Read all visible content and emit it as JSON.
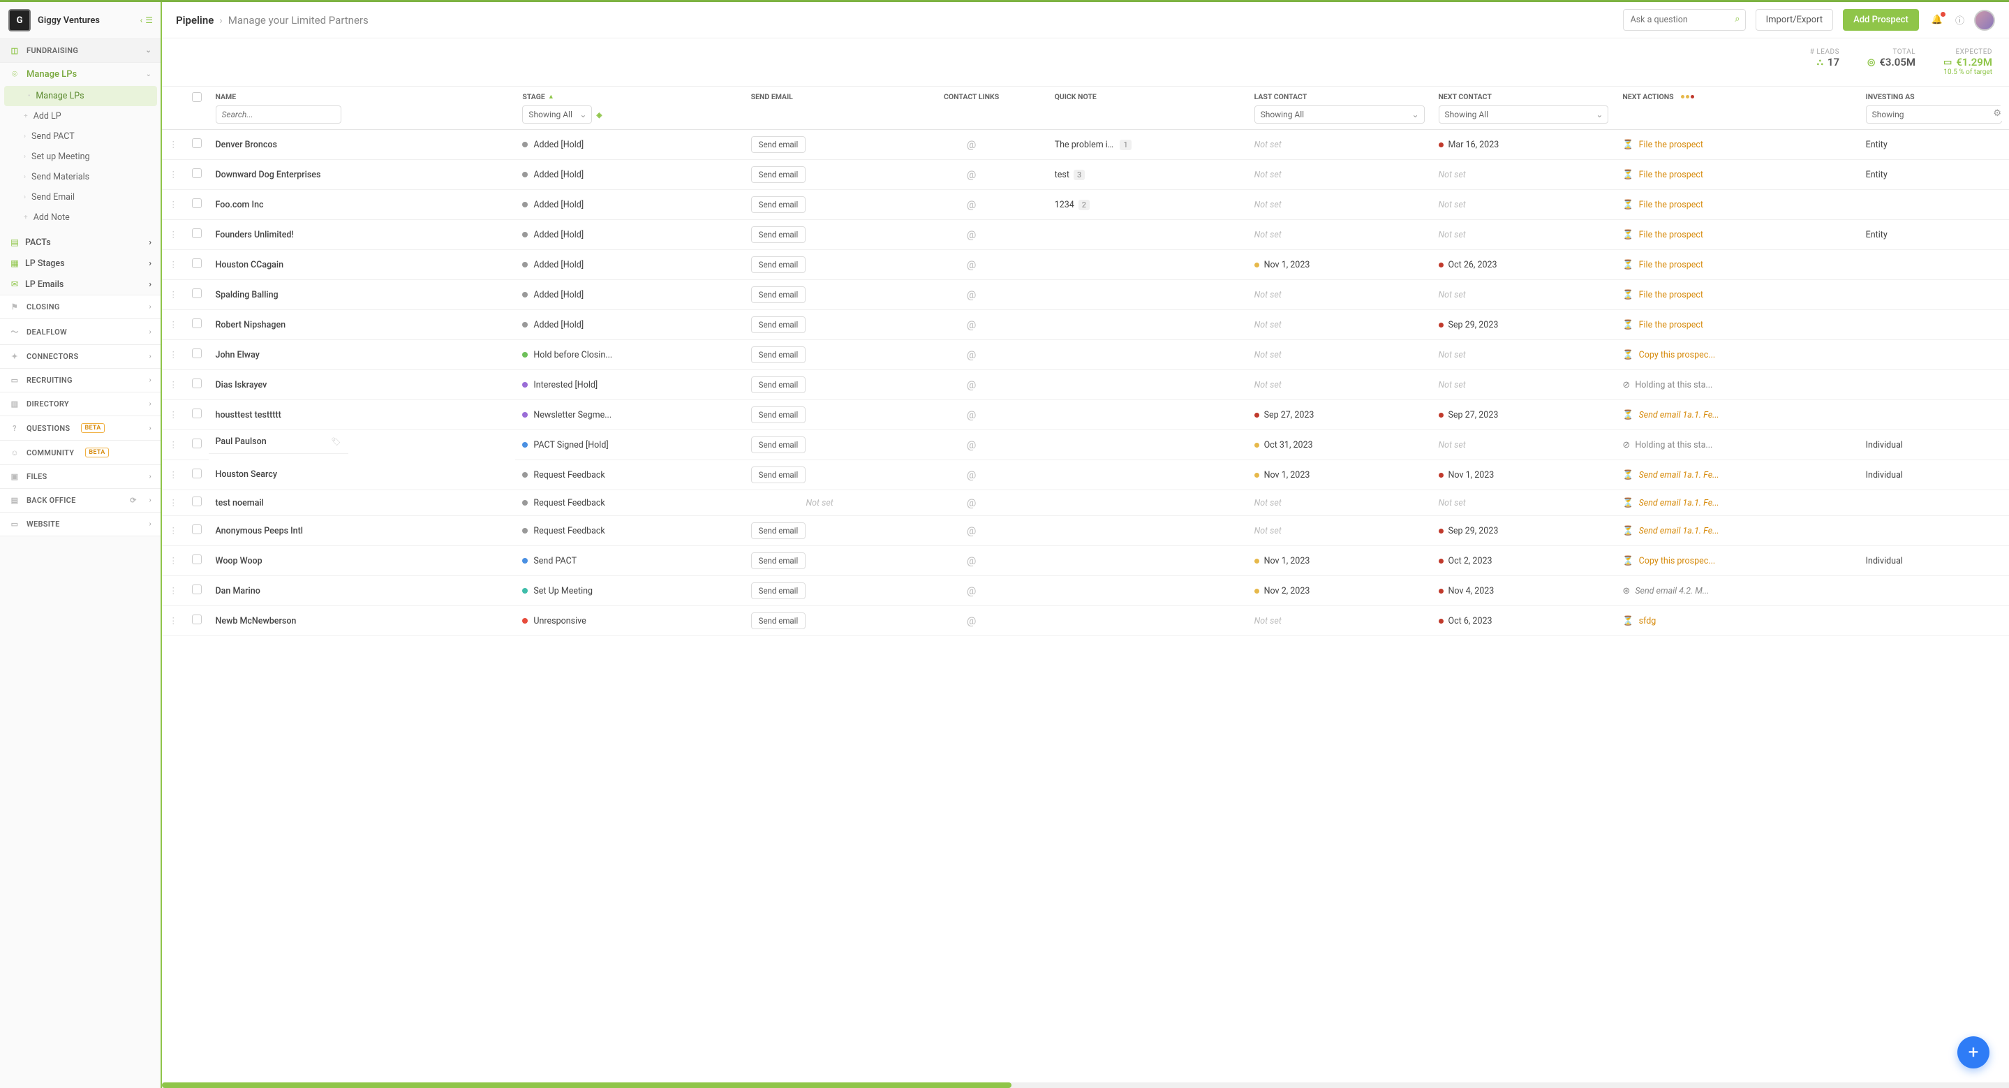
{
  "brand": {
    "logo": "G",
    "name": "Giggy Ventures"
  },
  "header": {
    "crumb1": "Pipeline",
    "crumb2": "Manage your Limited Partners",
    "search_ph": "Ask a question",
    "import": "Import/Export",
    "add": "Add Prospect"
  },
  "sidebar": {
    "fundraising": "FUNDRAISING",
    "manage_lps": "Manage LPs",
    "sub": {
      "manage": "Manage LPs",
      "add_lp": "Add LP",
      "send_pact": "Send PACT",
      "setup": "Set up Meeting",
      "materials": "Send Materials",
      "send_email": "Send Email",
      "add_note": "Add Note"
    },
    "pacts": "PACTs",
    "stages": "LP Stages",
    "emails": "LP Emails",
    "closing": "CLOSING",
    "dealflow": "DEALFLOW",
    "connectors": "CONNECTORS",
    "recruiting": "RECRUITING",
    "directory": "DIRECTORY",
    "questions": "QUESTIONS",
    "community": "COMMUNITY",
    "files": "FILES",
    "backoffice": "BACK OFFICE",
    "website": "WEBSITE",
    "beta": "BETA"
  },
  "metrics": {
    "leads_lbl": "# LEADS",
    "leads_val": "17",
    "total_lbl": "TOTAL",
    "total_val": "€3.05M",
    "exp_lbl": "EXPECTED",
    "exp_val": "€1.29M",
    "exp_sub": "10.5 % of target"
  },
  "cols": {
    "name": "NAME",
    "stage": "STAGE",
    "send": "SEND EMAIL",
    "links": "CONTACT LINKS",
    "note": "QUICK NOTE",
    "last": "LAST CONTACT",
    "next": "NEXT CONTACT",
    "actions": "NEXT ACTIONS",
    "invest": "INVESTING AS",
    "search_ph": "Search...",
    "showing": "Showing All",
    "showing2": "Showing"
  },
  "common": {
    "send_btn": "Send email",
    "notset": "Not set"
  },
  "rows": [
    {
      "name": "Denver Broncos",
      "stage": "Added [Hold]",
      "sc": "#999",
      "email": true,
      "note": "The problem is not...",
      "nc": "1",
      "last": "",
      "next": "Mar 16, 2023",
      "nd": "#c0392b",
      "action": "File the prospect",
      "ai": "⏳",
      "ac": "orange",
      "invest": "Entity"
    },
    {
      "name": "Downward Dog Enterprises",
      "stage": "Added [Hold]",
      "sc": "#999",
      "email": true,
      "note": "test",
      "nc": "3",
      "last": "",
      "next": "",
      "action": "File the prospect",
      "ai": "⏳",
      "ac": "orange",
      "invest": "Entity"
    },
    {
      "name": "Foo.com Inc",
      "stage": "Added [Hold]",
      "sc": "#999",
      "email": true,
      "note": "1234",
      "nc": "2",
      "last": "",
      "next": "",
      "action": "File the prospect",
      "ai": "⏳",
      "ac": "orange",
      "invest": ""
    },
    {
      "name": "Founders Unlimited!",
      "stage": "Added [Hold]",
      "sc": "#999",
      "email": true,
      "last": "",
      "next": "",
      "action": "File the prospect",
      "ai": "⏳",
      "ac": "orange",
      "invest": "Entity"
    },
    {
      "name": "Houston CCagain",
      "stage": "Added [Hold]",
      "sc": "#999",
      "email": true,
      "last": "Nov 1, 2023",
      "ld": "#e6b84a",
      "next": "Oct 26, 2023",
      "nd": "#c0392b",
      "action": "File the prospect",
      "ai": "⏳",
      "ac": "orange",
      "invest": ""
    },
    {
      "name": "Spalding Balling",
      "stage": "Added [Hold]",
      "sc": "#999",
      "email": true,
      "last": "",
      "next": "",
      "action": "File the prospect",
      "ai": "⏳",
      "ac": "orange",
      "invest": ""
    },
    {
      "name": "Robert Nipshagen",
      "stage": "Added [Hold]",
      "sc": "#999",
      "email": true,
      "last": "",
      "next": "Sep 29, 2023",
      "nd": "#c0392b",
      "action": "File the prospect",
      "ai": "⏳",
      "ac": "orange",
      "invest": ""
    },
    {
      "name": "John Elway",
      "stage": "Hold before Closin...",
      "sc": "#6ec05a",
      "email": true,
      "last": "",
      "next": "",
      "action": "Copy this prospec...",
      "ai": "⏳",
      "ac": "orange",
      "invest": ""
    },
    {
      "name": "Dias Iskrayev",
      "stage": "Interested [Hold]",
      "sc": "#9a6dd7",
      "email": true,
      "last": "",
      "next": "",
      "action": "Holding at this sta...",
      "ai": "⊘",
      "ac": "grey",
      "invest": ""
    },
    {
      "name": "housttest testtttt",
      "stage": "Newsletter Segme...",
      "sc": "#9a6dd7",
      "email": true,
      "last": "Sep 27, 2023",
      "ld": "#c0392b",
      "next": "Sep 27, 2023",
      "nd": "#c0392b",
      "action": "Send email 1a.1. Fe...",
      "ai": "⏳",
      "ac": "orange",
      "ital": true,
      "invest": ""
    },
    {
      "name": "Paul Paulson",
      "stage": "PACT Signed [Hold]",
      "sc": "#4a90e2",
      "email": true,
      "tag": true,
      "last": "Oct 31, 2023",
      "ld": "#e6b84a",
      "next": "",
      "action": "Holding at this sta...",
      "ai": "⊘",
      "ac": "grey",
      "invest": "Individual"
    },
    {
      "name": "Houston Searcy",
      "stage": "Request Feedback",
      "sc": "#999",
      "email": true,
      "last": "Nov 1, 2023",
      "ld": "#e6b84a",
      "next": "Nov 1, 2023",
      "nd": "#c0392b",
      "action": "Send email 1a.1. Fe...",
      "ai": "⏳",
      "ac": "orange",
      "ital": true,
      "invest": "Individual"
    },
    {
      "name": "test noemail",
      "stage": "Request Feedback",
      "sc": "#999",
      "email": false,
      "last": "",
      "next": "",
      "action": "Send email 1a.1. Fe...",
      "ai": "⏳",
      "ac": "orange",
      "ital": true,
      "invest": ""
    },
    {
      "name": "Anonymous Peeps Intl",
      "stage": "Request Feedback",
      "sc": "#999",
      "email": true,
      "last": "",
      "next": "Sep 29, 2023",
      "nd": "#c0392b",
      "action": "Send email 1a.1. Fe...",
      "ai": "⏳",
      "ac": "orange",
      "ital": true,
      "invest": ""
    },
    {
      "name": "Woop Woop",
      "stage": "Send PACT",
      "sc": "#4a90e2",
      "email": true,
      "last": "Nov 1, 2023",
      "ld": "#e6b84a",
      "next": "Oct 2, 2023",
      "nd": "#c0392b",
      "action": "Copy this prospec...",
      "ai": "⏳",
      "ac": "orange",
      "invest": "Individual"
    },
    {
      "name": "Dan Marino",
      "stage": "Set Up Meeting",
      "sc": "#3fbdaa",
      "email": true,
      "last": "Nov 2, 2023",
      "ld": "#e6b84a",
      "next": "Nov 4, 2023",
      "nd": "#c0392b",
      "action": "Send email 4.2. M...",
      "ai": "⊛",
      "ac": "grey",
      "ital": true,
      "invest": ""
    },
    {
      "name": "Newb McNewberson",
      "stage": "Unresponsive",
      "sc": "#e74c3c",
      "email": true,
      "last": "",
      "next": "Oct 6, 2023",
      "nd": "#c0392b",
      "action": "sfdg",
      "ai": "⏳",
      "ac": "orange",
      "invest": ""
    }
  ]
}
